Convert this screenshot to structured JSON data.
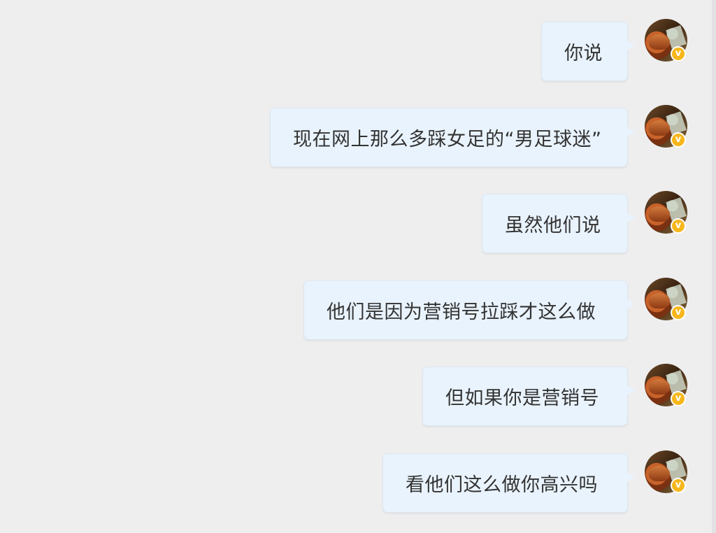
{
  "messages": [
    {
      "text": "你说"
    },
    {
      "text": "现在网上那么多踩女足的“男足球迷”"
    },
    {
      "text": "虽然他们说"
    },
    {
      "text": "他们是因为营销号拉踩才这么做"
    },
    {
      "text": "但如果你是营销号"
    },
    {
      "text": "看他们这么做你高兴吗"
    }
  ],
  "avatar": {
    "badge_glyph": "v",
    "badge_color": "#f7b71c"
  },
  "colors": {
    "background": "#eeeeee",
    "bubble": "#e9f3fd",
    "text": "#333333"
  }
}
